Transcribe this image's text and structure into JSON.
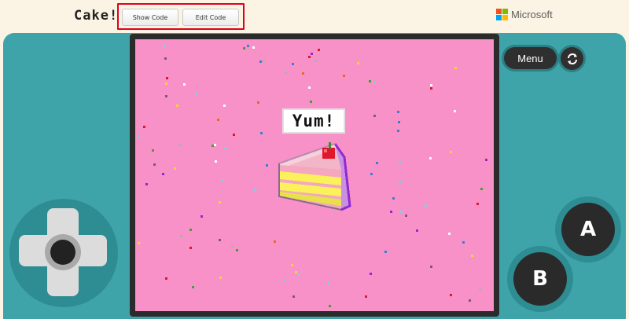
{
  "header": {
    "title": "Cake!",
    "show_code_label": "Show Code",
    "edit_code_label": "Edit Code",
    "brand": "Microsoft",
    "brand_colors": [
      "#f25022",
      "#7fba00",
      "#00a4ef",
      "#ffb900"
    ]
  },
  "game": {
    "speech_text": "Yum!",
    "background_color": "#f791c8"
  },
  "controls": {
    "menu_label": "Menu",
    "restart_icon": "refresh-icon",
    "a_label": "A",
    "b_label": "B"
  },
  "colors": {
    "console": "#3fa4aa",
    "page": "#fbf3e3",
    "highlight": "#e0001b"
  }
}
